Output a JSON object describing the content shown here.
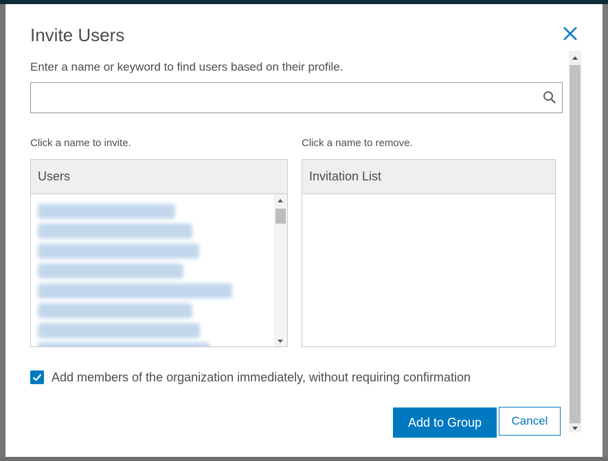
{
  "dialog": {
    "title": "Invite Users",
    "instructions": "Enter a name or keyword to find users based on their profile.",
    "search": {
      "value": "",
      "placeholder": ""
    },
    "users_hint": "Click a name to invite.",
    "invites_hint": "Click a name to remove.",
    "users_header": "Users",
    "invites_header": "Invitation List",
    "checkbox_label": "Add members of the organization immediately, without requiring confirmation",
    "checkbox_checked": true,
    "add_button": "Add to Group",
    "cancel_button": "Cancel"
  },
  "colors": {
    "accent": "#0079c1",
    "text": "#4c4c4c",
    "header_bg": "#efefef"
  },
  "icons": {
    "close": "close-icon",
    "search": "search-icon",
    "check": "check-icon"
  }
}
